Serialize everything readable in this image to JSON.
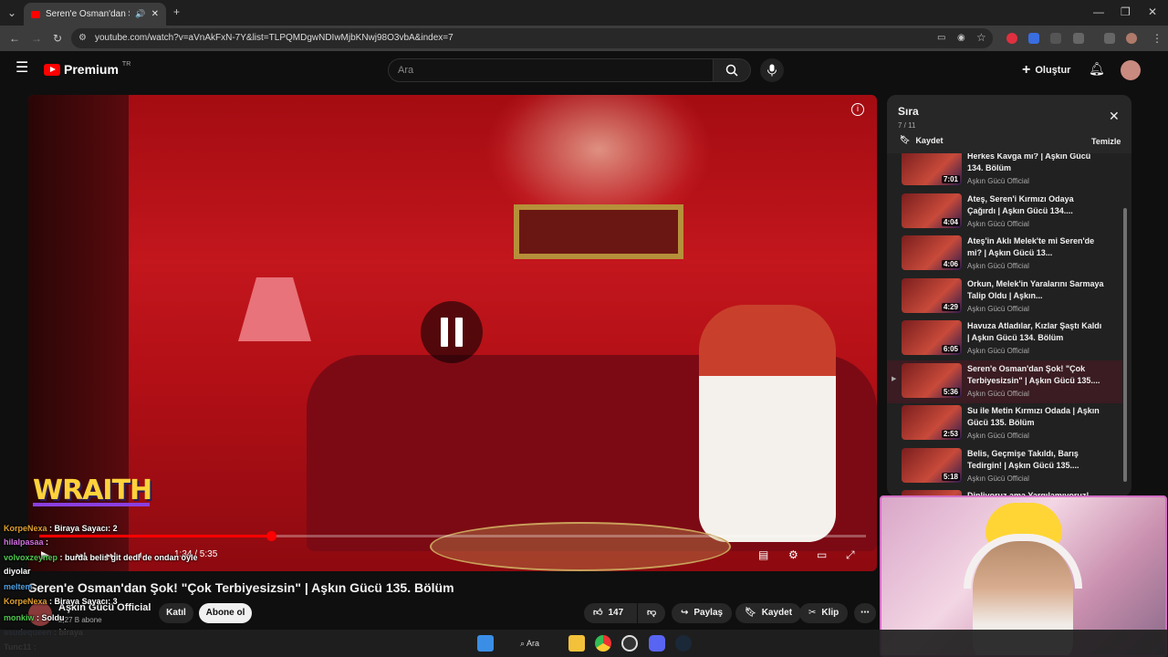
{
  "browser": {
    "tab_title": "Seren'e Osman'dan Şok! \"Ç",
    "url": "youtube.com/watch?v=aVnAkFxN-7Y&list=TLPQMDgwNDIwMjbKNwj98O3vbA&index=7"
  },
  "youtube": {
    "logo_text": "Premium",
    "country_code": "TR",
    "search_placeholder": "Ara",
    "create_label": "Oluştur"
  },
  "player": {
    "time": "1:34 / 5:35",
    "progress": 0.28,
    "overlay_logo": "WRAITH"
  },
  "video": {
    "title": "Seren'e Osman'dan Şok! \"Çok Terbiyesizsin\" | Aşkın Gücü 135. Bölüm",
    "channel": "Aşkın Gücü Official",
    "subscribers": "2,27 B abone",
    "join_label": "Katıl",
    "subscribe_label": "Abone ol",
    "likes": "147",
    "share_label": "Paylaş",
    "save_label": "Kaydet",
    "clip_label": "Klip"
  },
  "playlist": {
    "title": "Sıra",
    "position": "7 / 11",
    "save_label": "Kaydet",
    "clear_label": "Temizle",
    "items": [
      {
        "title": "Herkes Kavga mı? | Aşkın Gücü 134. Bölüm",
        "channel": "Aşkın Gücü Official",
        "duration": "7:01",
        "active": false
      },
      {
        "title": "Ateş, Seren'i Kırmızı Odaya Çağırdı | Aşkın Gücü 134....",
        "channel": "Aşkın Gücü Official",
        "duration": "4:04",
        "active": false
      },
      {
        "title": "Ateş'in Aklı Melek'te mi Seren'de mi? | Aşkın Gücü 13...",
        "channel": "Aşkın Gücü Official",
        "duration": "4:06",
        "active": false
      },
      {
        "title": "Orkun, Melek'in Yaralarını Sarmaya Talip Oldu | Aşkın...",
        "channel": "Aşkın Gücü Official",
        "duration": "4:29",
        "active": false
      },
      {
        "title": "Havuza Atladılar, Kızlar Şaştı Kaldı | Aşkın Gücü 134. Bölüm",
        "channel": "Aşkın Gücü Official",
        "duration": "6:05",
        "active": false
      },
      {
        "title": "Seren'e Osman'dan Şok! \"Çok Terbiyesizsin\" | Aşkın Gücü 135....",
        "channel": "Aşkın Gücü Official",
        "duration": "5:36",
        "active": true
      },
      {
        "title": "Su ile Metin Kırmızı Odada | Aşkın Gücü 135. Bölüm",
        "channel": "Aşkın Gücü Official",
        "duration": "2:53",
        "active": false
      },
      {
        "title": "Belis, Geçmişe Takıldı, Barış Tedirgin! | Aşkın Gücü 135....",
        "channel": "Aşkın Gücü Official",
        "duration": "5:18",
        "active": false
      },
      {
        "title": "Dinliyoruz ama Yargılamıyoruz!",
        "channel": "",
        "duration": "",
        "active": false
      }
    ]
  },
  "chat": [
    {
      "user": "KorpeNexa",
      "msg": ": Biraya Sayacı: 2",
      "color": "#e0a030"
    },
    {
      "user": "hilalpasaa",
      "msg": ":",
      "color": "#d070e0"
    },
    {
      "user": "volvoxzeynep",
      "msg": ": burda belis git dedi de ondan öyle",
      "color": "#50c850"
    },
    {
      "user": "",
      "msg": "diyolar",
      "color": "#ffffff"
    },
    {
      "user": "meltem",
      "msg": ":",
      "color": "#50a0e0"
    },
    {
      "user": "KorpeNexa",
      "msg": ": Biraya Sayacı: 3",
      "color": "#e0a030"
    },
    {
      "user": "monkiw",
      "msg": ": Soldu",
      "color": "#50c850"
    },
    {
      "user": "asudequeen",
      "msg": ": biraya",
      "color": "#70a0ff"
    },
    {
      "user": "Tunc11",
      "msg": ":",
      "color": "#ffffff"
    }
  ],
  "taskbar": {
    "search_label": "Ara"
  }
}
